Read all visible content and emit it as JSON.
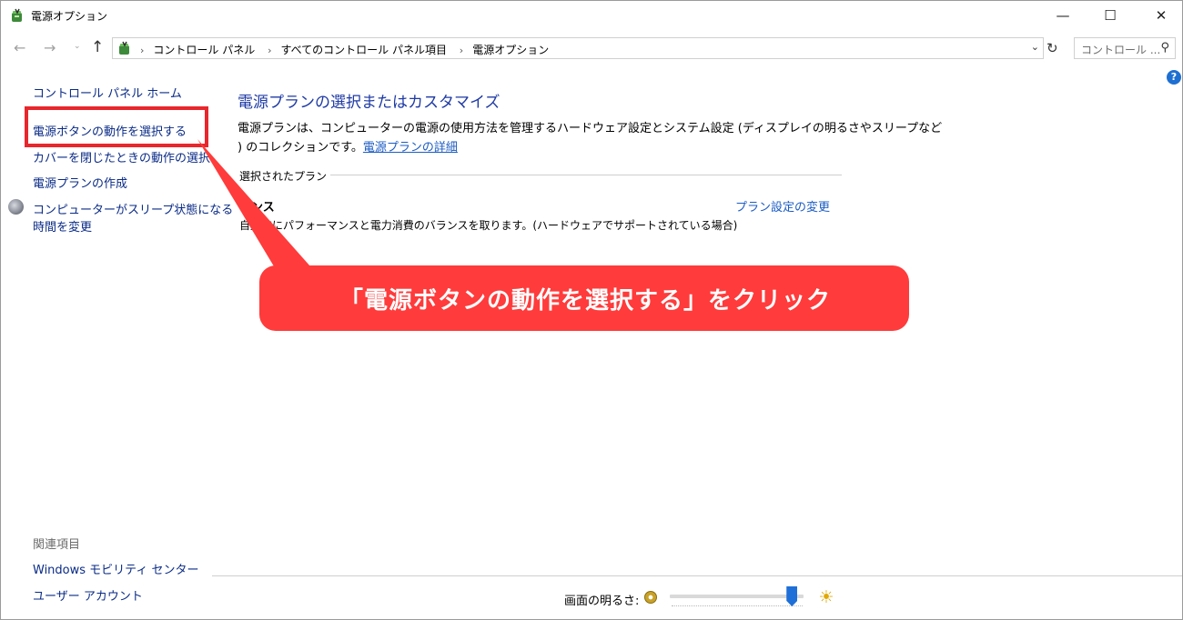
{
  "window": {
    "title": "電源オプション",
    "minimize_glyph": "—",
    "maximize_glyph": "☐",
    "close_glyph": "✕"
  },
  "navigation": {
    "back_glyph": "←",
    "forward_glyph": "→",
    "history_glyph": "⌄",
    "up_glyph": "↑",
    "breadcrumb_sep": "›",
    "breadcrumbs": [
      "コントロール パネル",
      "すべてのコントロール パネル項目",
      "電源オプション"
    ],
    "dropdown_glyph": "⌄",
    "refresh_glyph": "↻",
    "search_placeholder": "コントロール ...",
    "search_glyph": "⚲"
  },
  "help": {
    "glyph": "?"
  },
  "sidebar": {
    "home": "コントロール パネル ホーム",
    "items": [
      "電源ボタンの動作を選択する",
      "カバーを閉じたときの動作の選択",
      "電源プランの作成",
      "コンピューターがスリープ状態になる",
      "時間を変更"
    ],
    "related_title": "関連項目",
    "related": [
      "Windows モビリティ センター",
      "ユーザー アカウント"
    ]
  },
  "main": {
    "title": "電源プランの選択またはカスタマイズ",
    "description_line1": "電源プランは、コンピューターの電源の使用方法を管理するハードウェア設定とシステム設定 (ディスプレイの明るさやスリープなど",
    "description_line2_prefix": ") のコレクションです。",
    "description_link": "電源プランの詳細",
    "section_heading": "選択されたプラン",
    "plan_name": "ランス",
    "plan_description": "自動的にパフォーマンスと電力消費のバランスを取ります。(ハードウェアでサポートされている場合)",
    "plan_change_link": "プラン設定の変更"
  },
  "callout": {
    "text": "「電源ボタンの動作を選択する」をクリック",
    "color": "#ff3b3b",
    "box_color": "#e8262c"
  },
  "bottom": {
    "brightness_label": "画面の明るさ:",
    "brightness_level": 0.95,
    "sun_glyph": "☀"
  },
  "colors": {
    "link": "#0a2b87",
    "title_blue": "#1e3aa5",
    "slider_thumb": "#1f6fd8"
  },
  "icons": {
    "app": "power-options-icon",
    "sleep": "moon-icon",
    "help": "help-icon"
  }
}
